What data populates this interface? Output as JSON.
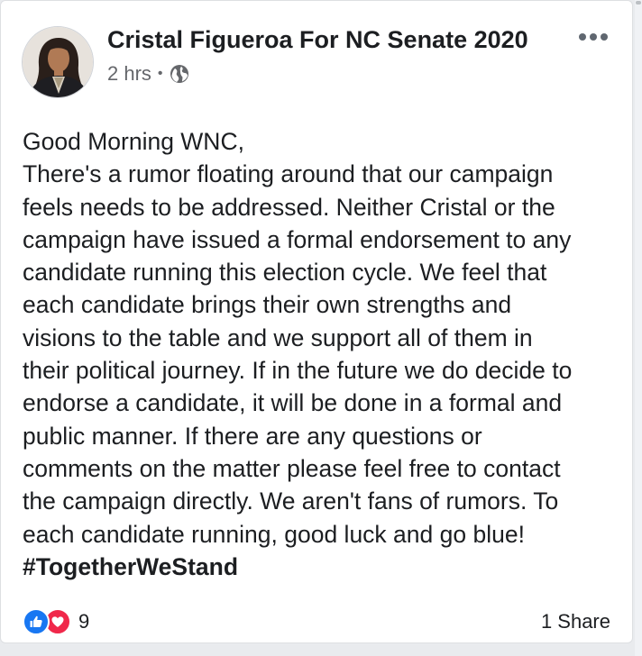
{
  "post": {
    "page_name": "Cristal Figueroa For NC Senate 2020",
    "timestamp": "2 hrs",
    "separator": "•",
    "privacy_icon": "globe-icon",
    "text_lines": [
      "Good Morning WNC,",
      "There's a rumor floating around that our campaign",
      "feels needs to be addressed. Neither Cristal or the",
      "campaign have issued a formal endorsement to any",
      "candidate running this election cycle. We feel that",
      "each candidate brings their own strengths and",
      "visions to the table and we support all of them in",
      "their political journey. If in the future we do decide to",
      "endorse a candidate, it will be done in a formal and",
      "public manner. If there are any questions or",
      "comments on the matter please feel free to contact",
      "the campaign directly. We aren't fans of rumors. To",
      "each candidate running, good luck and go blue!"
    ],
    "hashtag": "#TogetherWeStand"
  },
  "footer": {
    "reaction_icons": [
      "like-icon",
      "love-icon"
    ],
    "reaction_count": "9",
    "shares": "1 Share"
  },
  "colors": {
    "like": "#1877f2",
    "love": "#f0284a",
    "name_text": "#1c1e21",
    "meta_text": "#65676b"
  }
}
